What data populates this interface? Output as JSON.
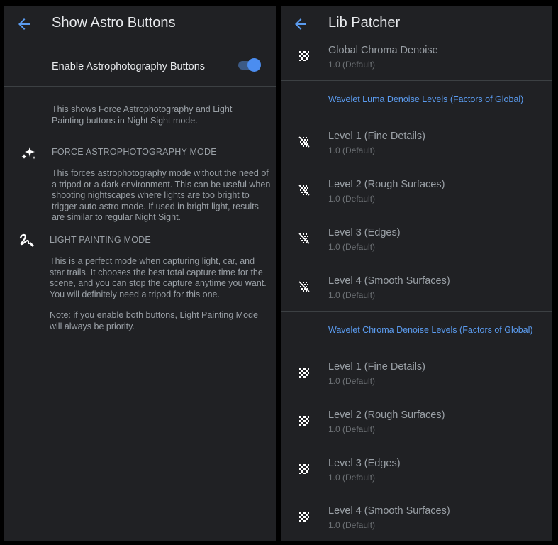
{
  "left": {
    "title": "Show Astro Buttons",
    "toggle_label": "Enable Astrophotography Buttons",
    "toggle_on": true,
    "intro": "This shows Force Astrophotography and Light Painting buttons in Night Sight mode.",
    "force_heading": "FORCE ASTROPHOTOGRAPHY MODE",
    "force_body": "This forces astrophotography mode without the need of a tripod or a dark environment. This can be useful when shooting nightscapes where lights are too bright to trigger auto astro mode. If used in bright light, results are similar to regular Night Sight.",
    "light_heading": "LIGHT PAINTING MODE",
    "light_body": "This is a perfect mode when capturing light, car, and star trails. It chooses the best total capture time for the scene, and you can stop the capture anytime you want. You will definitely need a tripod for this one.",
    "note": "Note: if you enable both buttons, Light Painting Mode will always be priority."
  },
  "right": {
    "title": "Lib Patcher",
    "global": {
      "title": "Global Chroma Denoise",
      "value": "1.0 (Default)"
    },
    "luma_section": "Wavelet Luma Denoise Levels (Factors of Global)",
    "luma_items": [
      {
        "title": "Level 1 (Fine Details)",
        "value": "1.0 (Default)"
      },
      {
        "title": "Level 2 (Rough Surfaces)",
        "value": "1.0 (Default)"
      },
      {
        "title": "Level 3 (Edges)",
        "value": "1.0 (Default)"
      },
      {
        "title": "Level 4 (Smooth Surfaces)",
        "value": "1.0 (Default)"
      }
    ],
    "chroma_section": "Wavelet Chroma Denoise Levels (Factors of Global)",
    "chroma_items": [
      {
        "title": "Level 1 (Fine Details)",
        "value": "1.0 (Default)"
      },
      {
        "title": "Level 2 (Rough Surfaces)",
        "value": "1.0 (Default)"
      },
      {
        "title": "Level 3 (Edges)",
        "value": "1.0 (Default)"
      },
      {
        "title": "Level 4 (Smooth Surfaces)",
        "value": "1.0 (Default)"
      }
    ]
  },
  "colors": {
    "accent": "#4b8df0",
    "section": "#5b9cf0",
    "background": "#202124"
  }
}
